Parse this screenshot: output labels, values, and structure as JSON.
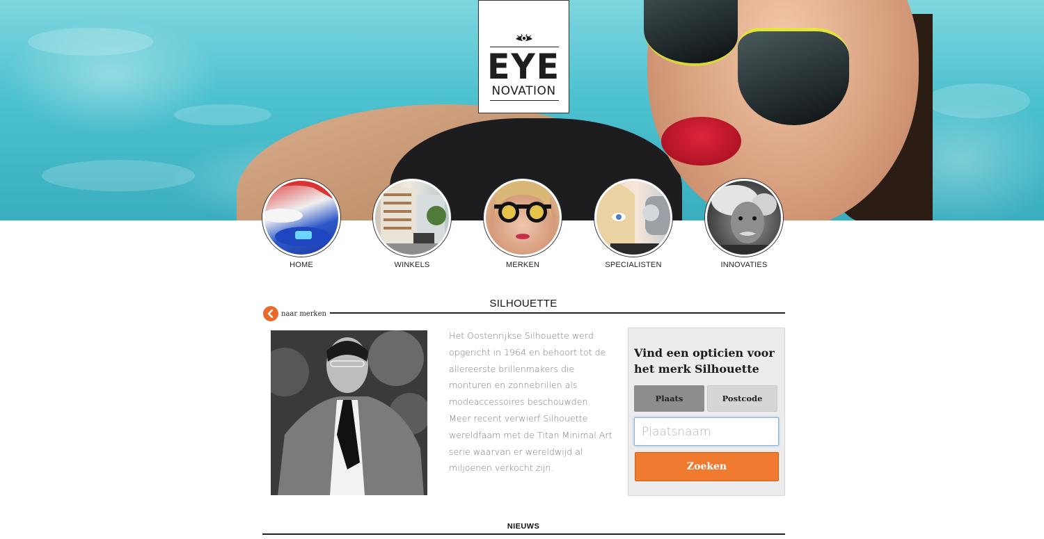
{
  "logo": {
    "line1": "EYE",
    "line2": "NOVATION"
  },
  "nav": {
    "items": [
      {
        "label": "HOME"
      },
      {
        "label": "WINKELS"
      },
      {
        "label": "MERKEN"
      },
      {
        "label": "SPECIALISTEN"
      },
      {
        "label": "INNOVATIES"
      }
    ]
  },
  "page": {
    "title": "SILHOUETTE",
    "back_label": "naar merken"
  },
  "description": "Het Oostenrijkse Silhouette werd opgericht in 1964 en behoort tot de allereerste brillenmakers die monturen en zonnebrillen als modeaccessoires beschouwden. Meer recent verwierf Silhouette wereldfaam met de Titan Minimal Art serie waarvan er wereldwijd al miljoenen verkocht zijn.",
  "search": {
    "title": "Vind een opticien voor het merk Silhouette",
    "tab_plaats": "Plaats",
    "tab_postcode": "Postcode",
    "placeholder": "Plaatsnaam",
    "button_label": "Zoeken"
  },
  "news": {
    "title": "NIEUWS"
  },
  "colors": {
    "accent": "#ef7a30",
    "tab_active": "#8d8d8d",
    "panel_bg": "#ececec"
  }
}
